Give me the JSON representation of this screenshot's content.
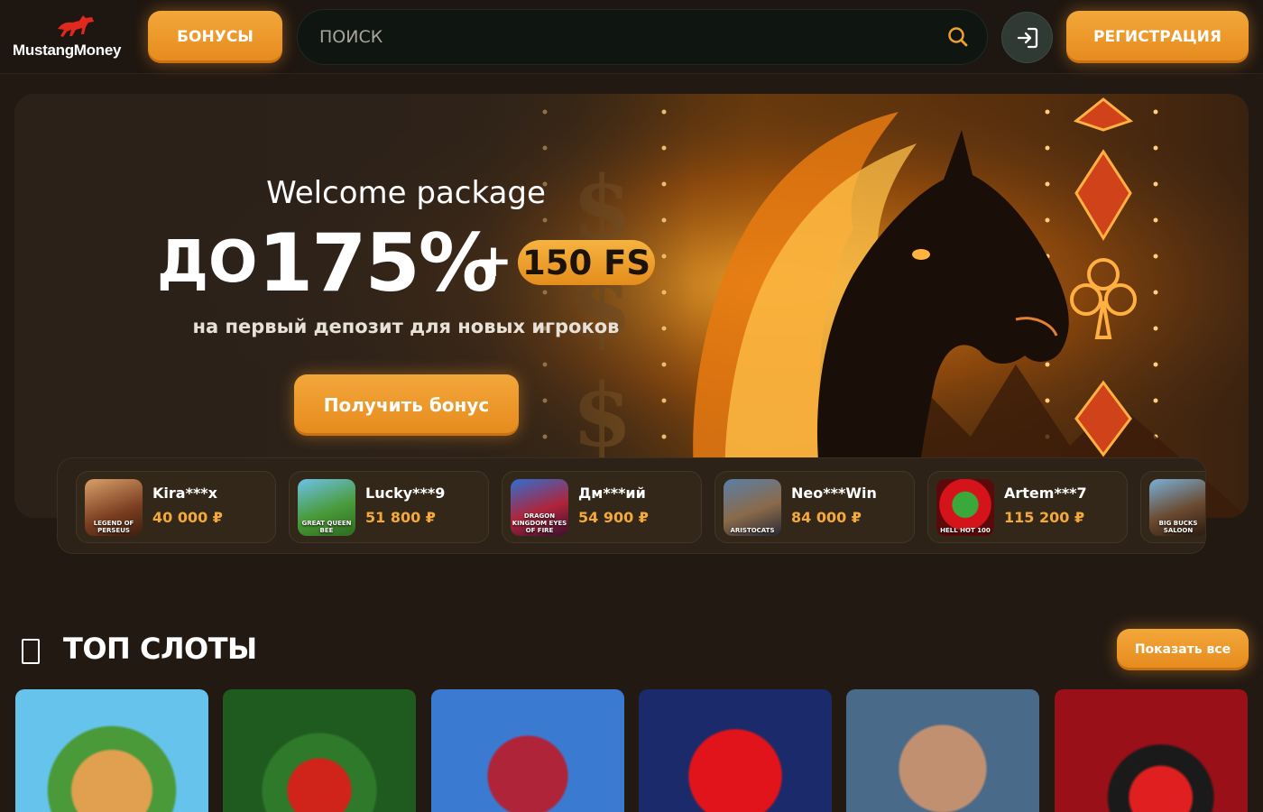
{
  "header": {
    "logo_text": "MustangMoney",
    "bonus_label": "БОНУСЫ",
    "search_placeholder": "ПОИСК",
    "register_label": "РЕГИСТРАЦИЯ"
  },
  "hero": {
    "welcome": "Welcome package",
    "prefix": "ДО",
    "percent": "175%",
    "plus": "+",
    "fs": "150 FS",
    "subtitle": "на первый депозит для новых игроков",
    "cta": "Получить бонус"
  },
  "winners": [
    {
      "name": "Kira***x",
      "amount": "40 000 ₽",
      "game": "LEGEND OF PERSEUS"
    },
    {
      "name": "Lucky***9",
      "amount": "51 800 ₽",
      "game": "GREAT QUEEN BEE"
    },
    {
      "name": "Дм***ий",
      "amount": "54 900 ₽",
      "game": "DRAGON KINGDOM EYES OF FIRE"
    },
    {
      "name": "Neo***Win",
      "amount": "84 000 ₽",
      "game": "ARISTOCATS"
    },
    {
      "name": "Artem***7",
      "amount": "115 200 ₽",
      "game": "HELL HOT 100"
    },
    {
      "name": "",
      "amount": "",
      "game": "BIG BUCKS SALOON"
    }
  ],
  "top_slots": {
    "title": "ТОП СЛОТЫ",
    "show_all": "Показать все"
  },
  "colors": {
    "accent": "#f0a030",
    "background": "#221913",
    "amount": "#f4a93a"
  }
}
